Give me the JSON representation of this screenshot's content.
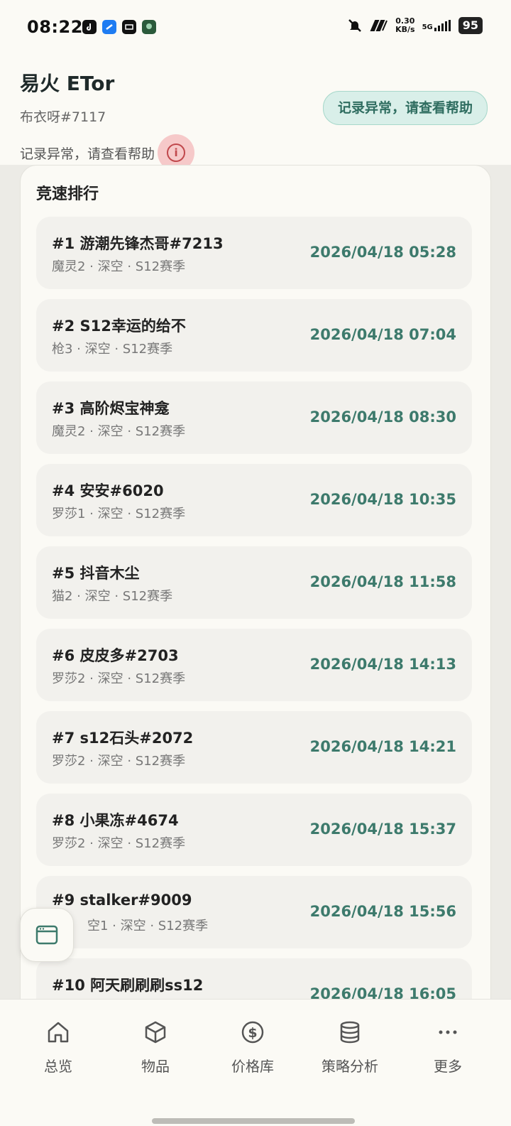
{
  "status_bar": {
    "time": "08:22",
    "speed_value": "0.30",
    "speed_unit": "KB/s",
    "network": "5G",
    "battery": "95"
  },
  "header": {
    "app_title": "易火 ETor",
    "user_tag": "布衣呀#7117",
    "record_text": "记录异常，请查看帮助",
    "help_button_label": "记录异常，请查看帮助"
  },
  "ranking": {
    "title": "竞速排行",
    "items": [
      {
        "name": "#1 游潮先锋杰哥#7213",
        "sub": "魔灵2 · 深空 · S12赛季",
        "time": "2026/04/18 05:28"
      },
      {
        "name": "#2 S12幸运的给不",
        "sub": "枪3 · 深空 · S12赛季",
        "time": "2026/04/18 07:04"
      },
      {
        "name": "#3 高阶烬宝神龛",
        "sub": "魔灵2 · 深空 · S12赛季",
        "time": "2026/04/18 08:30"
      },
      {
        "name": "#4 安安#6020",
        "sub": "罗莎1 · 深空 · S12赛季",
        "time": "2026/04/18 10:35"
      },
      {
        "name": "#5 抖音木尘",
        "sub": "猫2 · 深空 · S12赛季",
        "time": "2026/04/18 11:58"
      },
      {
        "name": "#6 皮皮多#2703",
        "sub": "罗莎2 · 深空 · S12赛季",
        "time": "2026/04/18 14:13"
      },
      {
        "name": "#7 s12石头#2072",
        "sub": "罗莎2 · 深空 · S12赛季",
        "time": "2026/04/18 14:21"
      },
      {
        "name": "#8 小果冻#4674",
        "sub": "罗莎2 · 深空 · S12赛季",
        "time": "2026/04/18 15:37"
      },
      {
        "name": "#9 stalker#9009",
        "sub": "空1 · 深空 · S12赛季",
        "time": "2026/04/18 15:56"
      },
      {
        "name": "#10 阿天刷刷刷ss12",
        "sub": "",
        "time": "2026/04/18 16:05"
      }
    ]
  },
  "bottom_nav": [
    {
      "label": "总览",
      "icon": "home-icon"
    },
    {
      "label": "物品",
      "icon": "box-icon"
    },
    {
      "label": "价格库",
      "icon": "dollar-icon"
    },
    {
      "label": "策略分析",
      "icon": "database-icon"
    },
    {
      "label": "更多",
      "icon": "more-icon"
    }
  ],
  "colors": {
    "accent": "#3d7a6c",
    "pill_bg": "#d9efe9",
    "info_bg": "#f6c9c9",
    "background": "#fbfaf5"
  }
}
